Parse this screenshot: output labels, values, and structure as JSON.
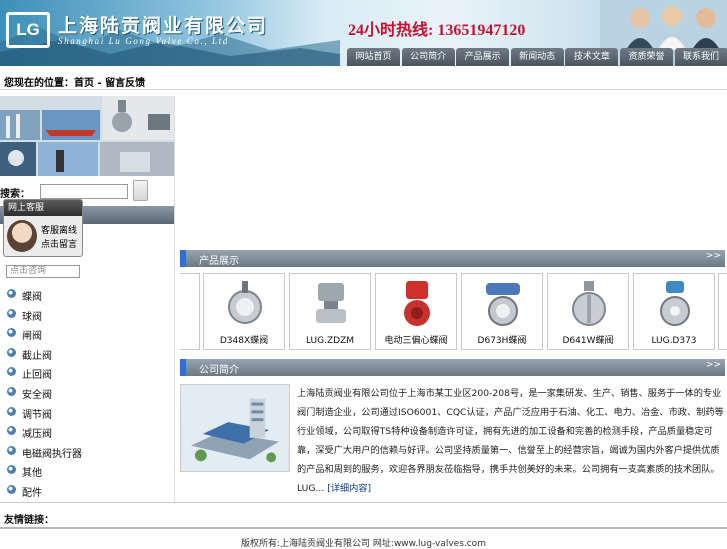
{
  "header": {
    "logo_text": "LG",
    "company_cn": "上海陆贡阀业有限公司",
    "company_en": "Shanghai Lu Gong Valve Co., Ltd",
    "hotline": "24小时热线: 13651947120",
    "nav": [
      "网站首页",
      "公司简介",
      "产品展示",
      "新闻动态",
      "技术文章",
      "资质荣誉",
      "联系我们"
    ]
  },
  "breadcrumb": "您现在的位置：首页 - 留言反馈",
  "sidebar": {
    "search_label": "搜索：",
    "search_placeholder": "",
    "service": {
      "title": "网上客服",
      "line1": "客服离线",
      "line2": "点击留言"
    },
    "consult_placeholder": "点击咨询",
    "categories": [
      "蝶阀",
      "球阀",
      "闸阀",
      "截止阀",
      "止回阀",
      "安全阀",
      "调节阀",
      "减压阀",
      "电磁阀执行器",
      "其他",
      "配件"
    ]
  },
  "products": {
    "title": "产品展示",
    "more": ">>",
    "items": [
      {
        "label": "D348X蝶阀"
      },
      {
        "label": "LUG.ZDZM"
      },
      {
        "label": "电动三偏心蝶阀"
      },
      {
        "label": "D673H蝶阀"
      },
      {
        "label": "D641W蝶阀"
      },
      {
        "label": "LUG.D373"
      }
    ]
  },
  "about": {
    "title": "公司简介",
    "more": ">>",
    "text": "上海陆贡阀业有限公司位于上海市某工业区200-208号，是一家集研发、生产、销售、服务于一体的专业阀门制造企业，公司通过ISO6001、CQC认证，产品广泛应用于石油、化工、电力、冶金、市政、制药等行业领域，公司取得TS特种设备制造许可证，拥有先进的加工设备和完善的检测手段，产品质量稳定可靠，深受广大用户的信赖与好评。公司坚持质量第一、信誉至上的经营宗旨，竭诚为国内外客户提供优质的产品和周到的服务，欢迎各界朋友莅临指导，携手共创美好的未来。公司拥有一支高素质的技术团队。LUG...",
    "more_link": "[详细内容]"
  },
  "footer": {
    "left": "友情链接：",
    "copyright": "版权所有:上海陆贡阀业有限公司 网址:www.lug-valves.com"
  },
  "colors": {
    "nav_bg": "#4a545e",
    "section_accent": "#2f6fd1",
    "hotline": "#c8102e"
  }
}
